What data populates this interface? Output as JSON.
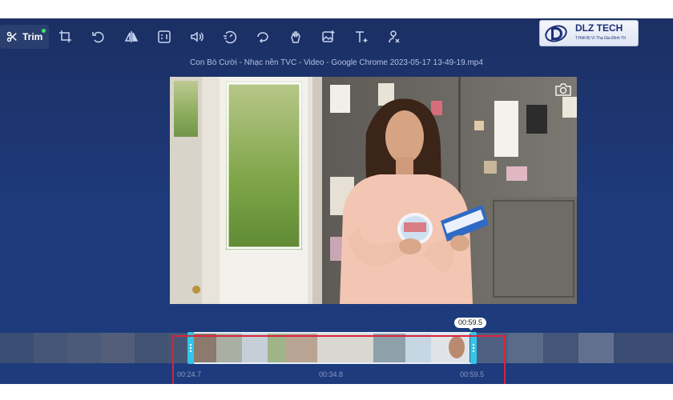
{
  "toolbar": {
    "trim_label": "Trim",
    "tools": [
      {
        "name": "crop-icon"
      },
      {
        "name": "rotate-icon"
      },
      {
        "name": "flip-icon"
      },
      {
        "name": "aspect-ratio-icon"
      },
      {
        "name": "volume-icon"
      },
      {
        "name": "speed-icon"
      },
      {
        "name": "loop-icon"
      },
      {
        "name": "stabilize-icon"
      },
      {
        "name": "add-image-icon"
      },
      {
        "name": "add-text-icon"
      },
      {
        "name": "remove-audio-icon"
      }
    ]
  },
  "logo": {
    "text": "DLZ TECH",
    "tagline": "T.Hiết Bị Vì Thạ Gia Đình Tít"
  },
  "video": {
    "title": "Con Bò Cười - Nhạc nền TVC - Video - Google Chrome 2023-05-17 13-49-19.mp4"
  },
  "timeline": {
    "current_time": "00:59.5",
    "start_time": "00:24.7",
    "mid_time": "00:34.8",
    "end_time": "00:59.5"
  },
  "colors": {
    "background": "#1e3a7a",
    "handle": "#33c6e8",
    "highlight": "#d8233c"
  }
}
